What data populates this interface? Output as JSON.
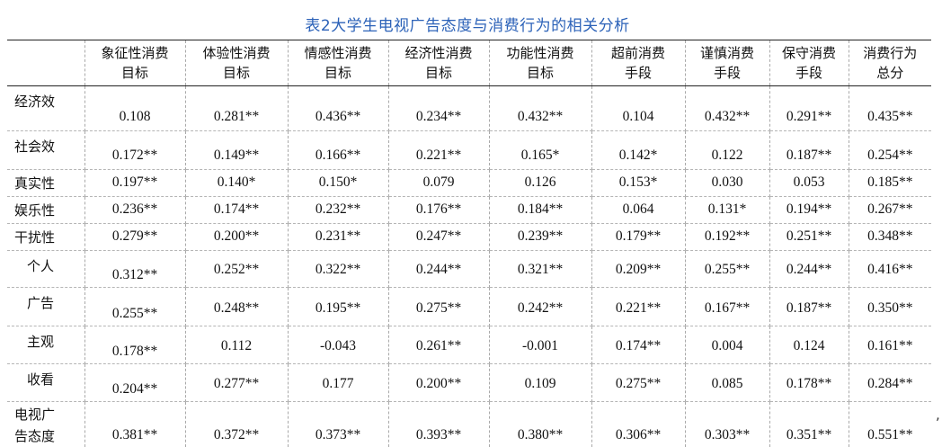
{
  "title": "表2大学生电视广告态度与消费行为的相关分析",
  "columns": [
    [
      "象征性消费",
      "目标"
    ],
    [
      "体验性消费",
      "目标"
    ],
    [
      "情感性消费",
      "目标"
    ],
    [
      "经济性消费",
      "目标"
    ],
    [
      "功能性消费",
      "目标"
    ],
    [
      "超前消费",
      "手段"
    ],
    [
      "谨慎消费",
      "手段"
    ],
    [
      "保守消费",
      "手段"
    ],
    [
      "消费行为",
      "总分"
    ]
  ],
  "rows": [
    {
      "label": "经济效",
      "values": [
        "0.108",
        "0.281**",
        "0.436**",
        "0.234**",
        "0.432**",
        "0.104",
        "0.432**",
        "0.291**",
        "0.435**"
      ]
    },
    {
      "label": "社会效",
      "values": [
        "0.172**",
        "0.149**",
        "0.166**",
        "0.221**",
        "0.165*",
        "0.142*",
        "0.122",
        "0.187**",
        "0.254**"
      ]
    },
    {
      "label": "真实性",
      "values": [
        "0.197**",
        "0.140*",
        "0.150*",
        "0.079",
        "0.126",
        "0.153*",
        "0.030",
        "0.053",
        "0.185**"
      ]
    },
    {
      "label": "娱乐性",
      "values": [
        "0.236**",
        "0.174**",
        "0.232**",
        "0.176**",
        "0.184**",
        "0.064",
        "0.131*",
        "0.194**",
        "0.267**"
      ]
    },
    {
      "label": "干扰性",
      "values": [
        "0.279**",
        "0.200**",
        "0.231**",
        "0.247**",
        "0.239**",
        "0.179**",
        "0.192**",
        "0.251**",
        "0.348**"
      ]
    },
    {
      "label": "个人",
      "values": [
        "0.312**",
        "0.252**",
        "0.322**",
        "0.244**",
        "0.321**",
        "0.209**",
        "0.255**",
        "0.244**",
        "0.416**"
      ]
    },
    {
      "label": "广告",
      "values": [
        "0.255**",
        "0.248**",
        "0.195**",
        "0.275**",
        "0.242**",
        "0.221**",
        "0.167**",
        "0.187**",
        "0.350**"
      ]
    },
    {
      "label": "主观",
      "values": [
        "0.178**",
        "0.112",
        "-0.043",
        "0.261**",
        "-0.001",
        "0.174**",
        "0.004",
        "0.124",
        "0.161**"
      ]
    },
    {
      "label": "收看",
      "values": [
        "0.204**",
        "0.277**",
        "0.177",
        "0.200**",
        "0.109",
        "0.275**",
        "0.085",
        "0.178**",
        "0.284**"
      ]
    },
    {
      "label": "电视广告态度",
      "label_lines": [
        "电视广",
        "告态度"
      ],
      "values": [
        "0.381**",
        "0.372**",
        "0.373**",
        "0.393**",
        "0.380**",
        "0.306**",
        "0.303**",
        "0.351**",
        "0.551**"
      ]
    }
  ],
  "trailing_mark": ","
}
